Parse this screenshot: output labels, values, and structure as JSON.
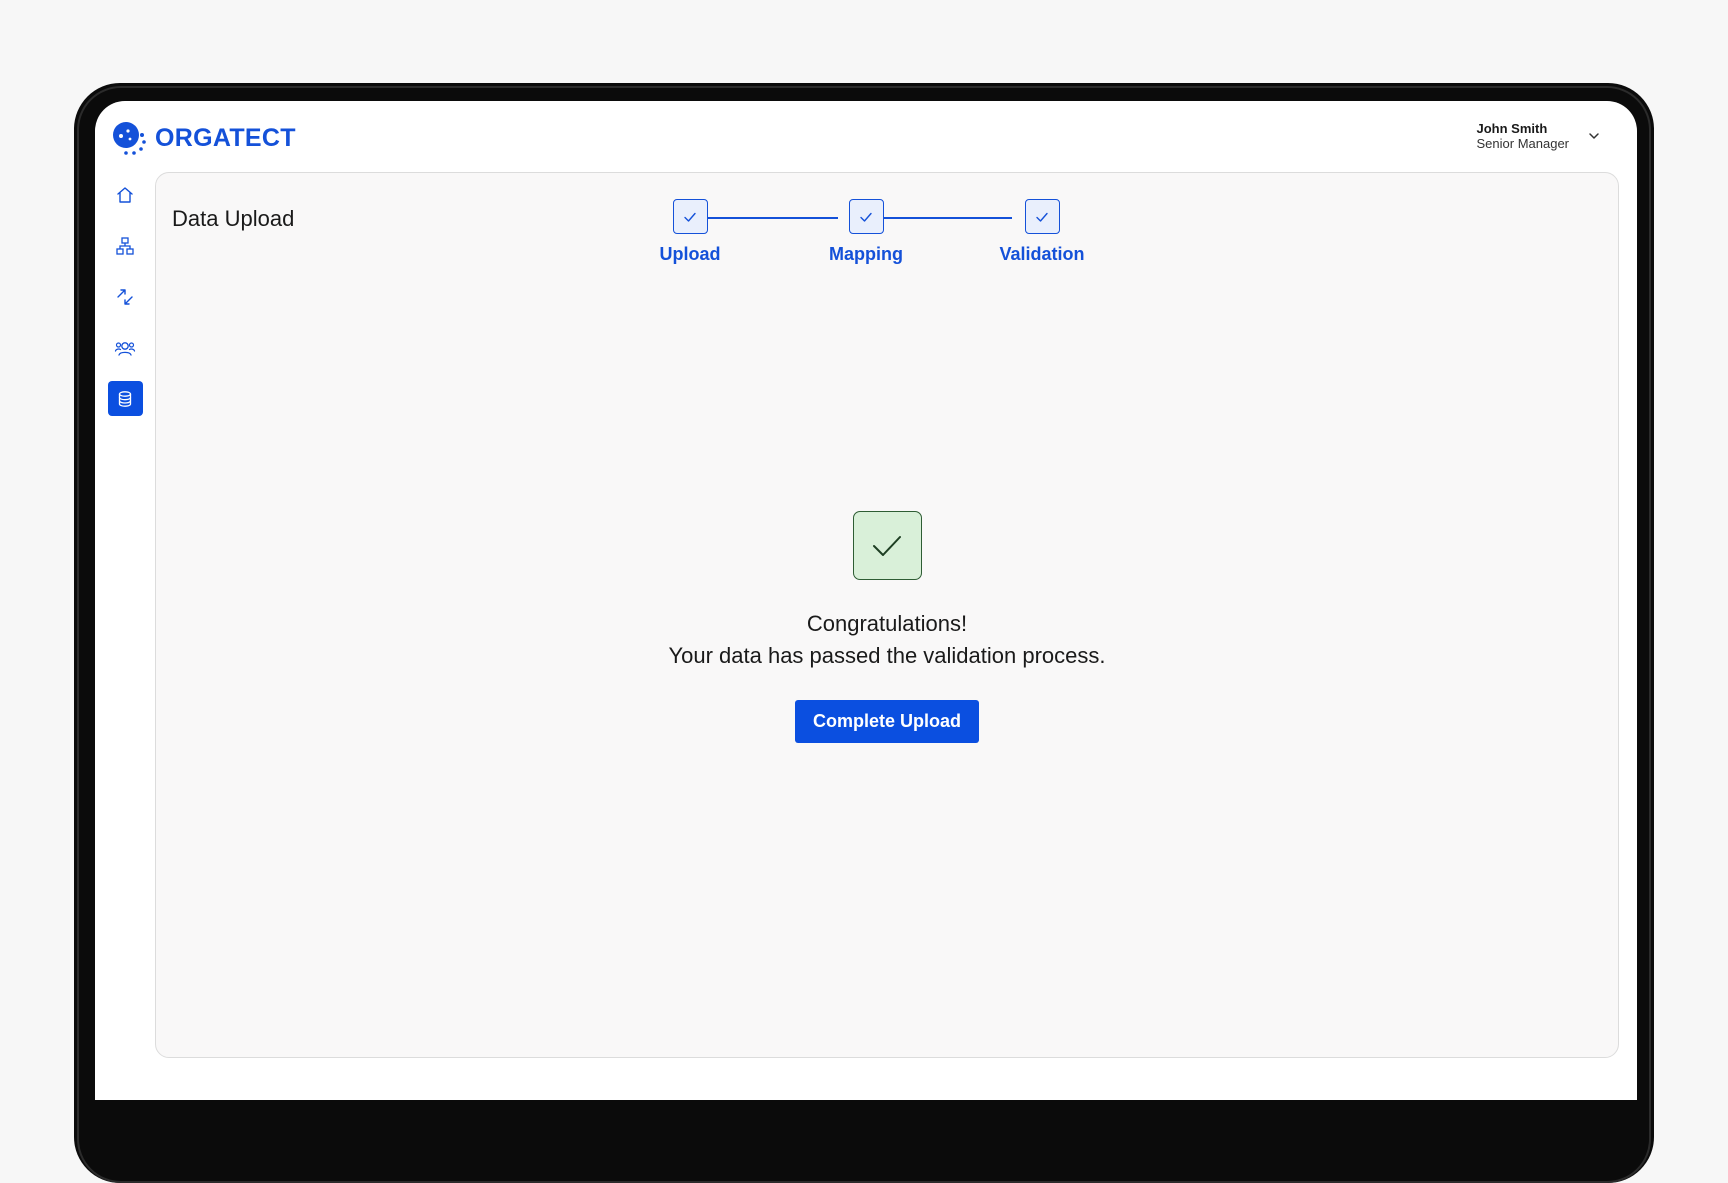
{
  "brand": {
    "name": "ORGATECT",
    "color": "#1451d9"
  },
  "user": {
    "name": "John Smith",
    "role": "Senior Manager"
  },
  "sidebar": {
    "items": [
      {
        "icon": "home-icon",
        "active": false
      },
      {
        "icon": "org-chart-icon",
        "active": false
      },
      {
        "icon": "transfer-arrows-icon",
        "active": false
      },
      {
        "icon": "users-icon",
        "active": false
      },
      {
        "icon": "database-icon",
        "active": true
      }
    ]
  },
  "page": {
    "title": "Data Upload"
  },
  "stepper": {
    "steps": [
      {
        "label": "Upload",
        "completed": true
      },
      {
        "label": "Mapping",
        "completed": true
      },
      {
        "label": "Validation",
        "completed": true
      }
    ]
  },
  "result": {
    "line1": "Congratulations!",
    "line2": "Your data has passed the validation process.",
    "button_label": "Complete Upload"
  },
  "colors": {
    "accent": "#0b4fe0",
    "success_bg": "#d9f0d9",
    "success_border": "#2e5d34"
  }
}
